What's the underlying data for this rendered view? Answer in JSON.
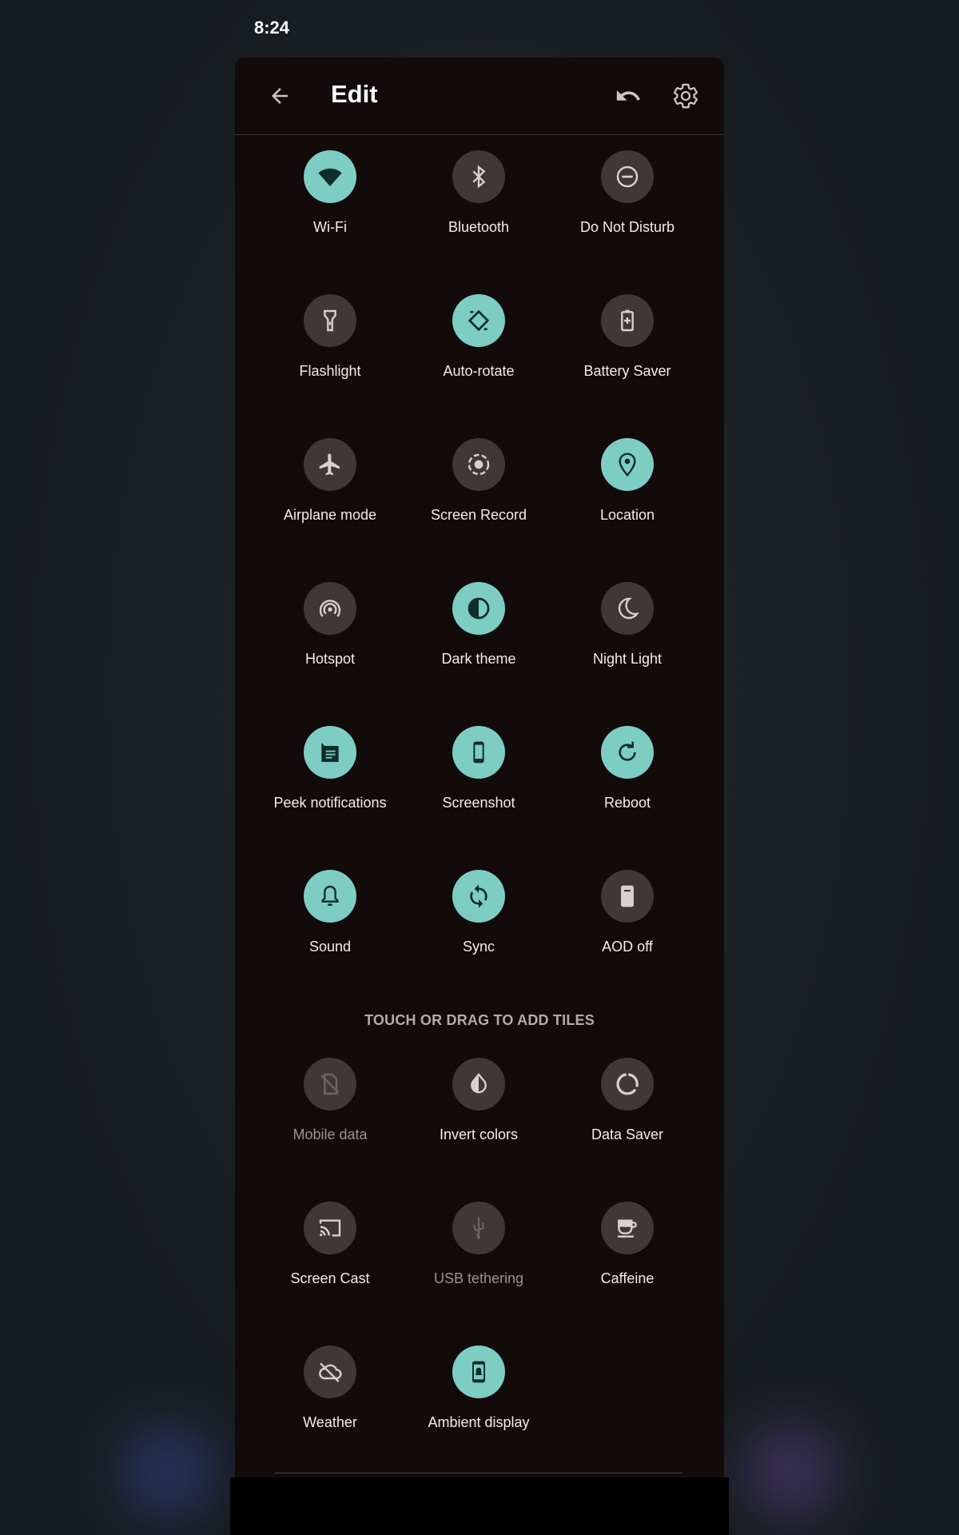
{
  "status_bar": {
    "time": "8:24"
  },
  "header": {
    "title": "Edit"
  },
  "section": {
    "add_tiles_label": "TOUCH OR DRAG TO ADD TILES"
  },
  "active_tiles": [
    {
      "label": "Wi-Fi",
      "state": "on",
      "icon": "wifi-icon"
    },
    {
      "label": "Bluetooth",
      "state": "off",
      "icon": "bluetooth-icon"
    },
    {
      "label": "Do Not Disturb",
      "state": "off",
      "icon": "do-not-disturb-icon"
    },
    {
      "label": "Flashlight",
      "state": "off",
      "icon": "flashlight-icon"
    },
    {
      "label": "Auto-rotate",
      "state": "on",
      "icon": "auto-rotate-icon"
    },
    {
      "label": "Battery Saver",
      "state": "off",
      "icon": "battery-saver-icon"
    },
    {
      "label": "Airplane mode",
      "state": "off",
      "icon": "airplane-icon"
    },
    {
      "label": "Screen Record",
      "state": "off",
      "icon": "screen-record-icon"
    },
    {
      "label": "Location",
      "state": "on",
      "icon": "location-icon"
    },
    {
      "label": "Hotspot",
      "state": "off",
      "icon": "hotspot-icon"
    },
    {
      "label": "Dark theme",
      "state": "on",
      "icon": "dark-theme-icon"
    },
    {
      "label": "Night Light",
      "state": "off",
      "icon": "night-light-icon"
    },
    {
      "label": "Peek notifications",
      "state": "on",
      "icon": "peek-notifications-icon"
    },
    {
      "label": "Screenshot",
      "state": "on",
      "icon": "screenshot-icon"
    },
    {
      "label": "Reboot",
      "state": "on",
      "icon": "reboot-icon"
    },
    {
      "label": "Sound",
      "state": "on",
      "icon": "sound-bell-icon"
    },
    {
      "label": "Sync",
      "state": "on",
      "icon": "sync-icon"
    },
    {
      "label": "AOD off",
      "state": "off",
      "icon": "aod-icon"
    }
  ],
  "available_tiles": [
    {
      "label": "Mobile data",
      "state": "unavailable",
      "icon": "mobile-data-off-icon"
    },
    {
      "label": "Invert colors",
      "state": "off",
      "icon": "invert-colors-icon"
    },
    {
      "label": "Data Saver",
      "state": "off",
      "icon": "data-saver-icon"
    },
    {
      "label": "Screen Cast",
      "state": "off",
      "icon": "screen-cast-icon"
    },
    {
      "label": "USB tethering",
      "state": "unavailable",
      "icon": "usb-icon"
    },
    {
      "label": "Caffeine",
      "state": "off",
      "icon": "caffeine-icon"
    },
    {
      "label": "Weather",
      "state": "off",
      "icon": "weather-cloud-off-icon"
    },
    {
      "label": "Ambient display",
      "state": "on",
      "icon": "ambient-display-icon"
    }
  ],
  "colors": {
    "panel": "#120a0b",
    "tile_on": "#7ecdc3",
    "tile_off": "#403737",
    "text": "#f2eded"
  }
}
